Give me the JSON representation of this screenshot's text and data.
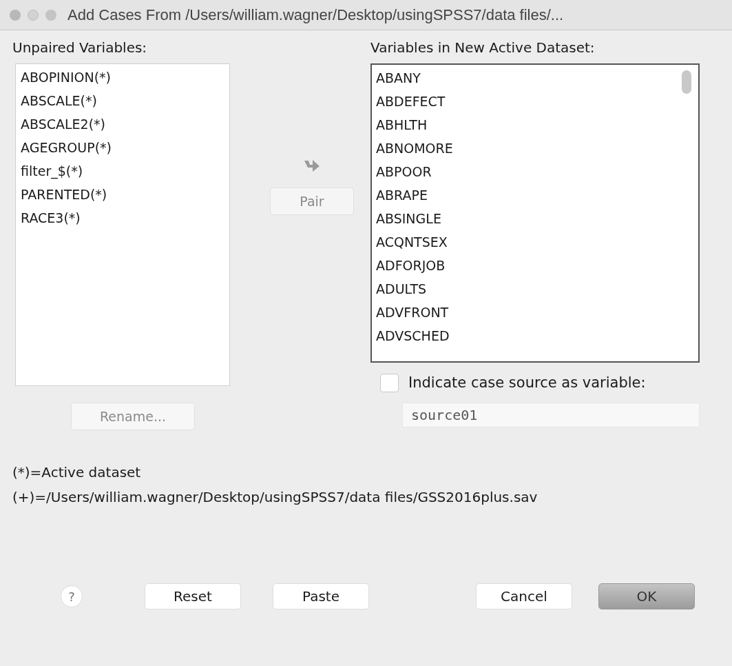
{
  "window": {
    "title": "Add Cases From /Users/william.wagner/Desktop/usingSPSS7/data files/..."
  },
  "unpaired": {
    "label": "Unpaired Variables:",
    "items": [
      "ABOPINION(*)",
      "ABSCALE(*)",
      "ABSCALE2(*)",
      "AGEGROUP(*)",
      "filter_$(*)",
      "PARENTED(*)",
      "RACE3(*)"
    ]
  },
  "pair_button": {
    "label": "Pair",
    "disabled": true
  },
  "move_button": {
    "disabled": true
  },
  "rename_button": {
    "label": "Rename...",
    "disabled": true
  },
  "active": {
    "label": "Variables in New Active Dataset:",
    "items": [
      "ABANY",
      "ABDEFECT",
      "ABHLTH",
      "ABNOMORE",
      "ABPOOR",
      "ABRAPE",
      "ABSINGLE",
      "ACQNTSEX",
      "ADFORJOB",
      "ADULTS",
      "ADVFRONT",
      "ADVSCHED"
    ]
  },
  "case_source": {
    "label": "Indicate case source as variable:",
    "checked": false,
    "value": "source01"
  },
  "legend": [
    "(*)=Active dataset",
    "(+)=/Users/william.wagner/Desktop/usingSPSS7/data files/GSS2016plus.sav"
  ],
  "help": "?",
  "buttons": [
    {
      "label": "Reset",
      "kind": "plain"
    },
    {
      "label": "Paste",
      "kind": "plain"
    },
    {
      "label": "Cancel",
      "kind": "plain"
    },
    {
      "label": "OK",
      "kind": "default"
    }
  ]
}
